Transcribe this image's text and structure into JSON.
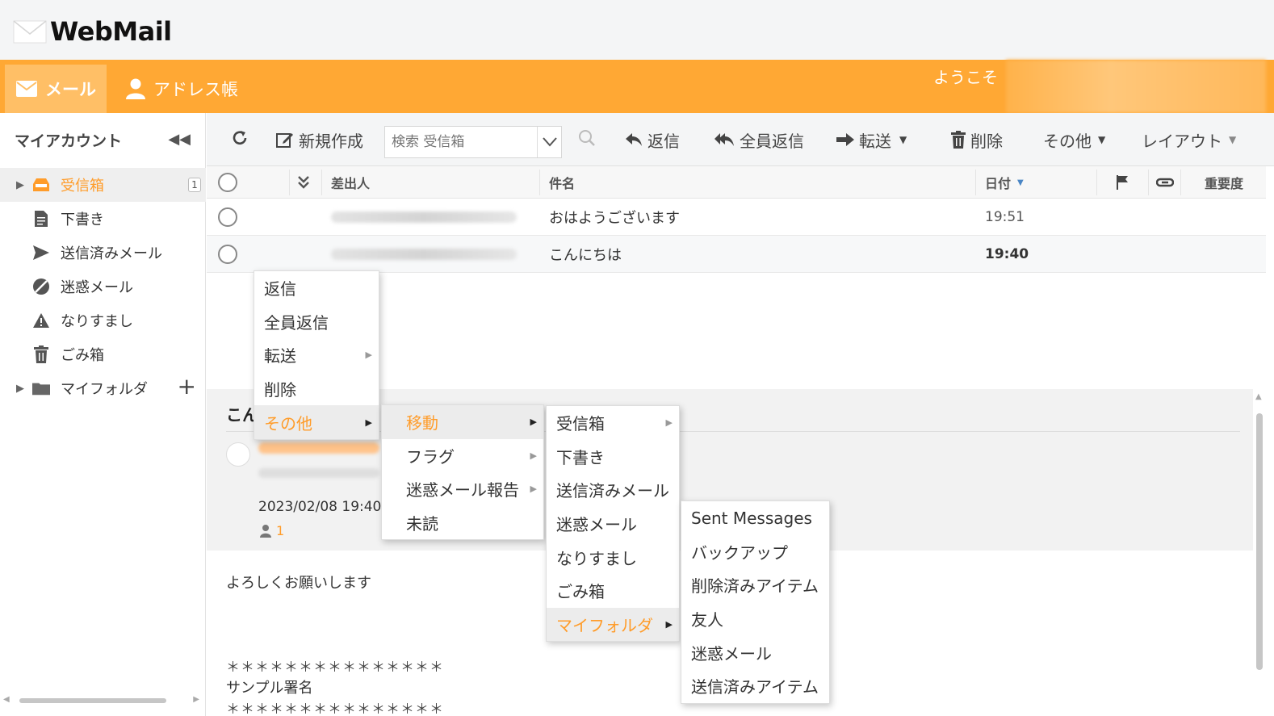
{
  "app": {
    "title": "WebMail"
  },
  "nav": {
    "mail": "メール",
    "address_book": "アドレス帳",
    "welcome": "ようこそ"
  },
  "sidebar": {
    "heading": "マイアカウント",
    "folders": [
      {
        "label": "受信箱",
        "badge": "1"
      },
      {
        "label": "下書き"
      },
      {
        "label": "送信済みメール"
      },
      {
        "label": "迷惑メール"
      },
      {
        "label": "なりすまし"
      },
      {
        "label": "ごみ箱"
      },
      {
        "label": "マイフォルダ"
      }
    ]
  },
  "toolbar": {
    "new": "新規作成",
    "search_placeholder": "検索 受信箱",
    "reply": "返信",
    "reply_all": "全員返信",
    "forward": "転送",
    "delete": "削除",
    "other": "その他",
    "layout": "レイアウト"
  },
  "list": {
    "columns": {
      "sender": "差出人",
      "subject": "件名",
      "date": "日付",
      "importance": "重要度"
    },
    "rows": [
      {
        "subject": "おはようございます",
        "time": "19:51"
      },
      {
        "subject": "こんにちは",
        "time": "19:40"
      }
    ]
  },
  "preview": {
    "subject": "こん",
    "date": "2023/02/08 19:40",
    "recipient_count": "1",
    "body": "よろしくお願いします",
    "stars": "＊＊＊＊＊＊＊＊＊＊＊＊＊＊＊",
    "signature": "サンプル署名"
  },
  "context_menu": {
    "main": [
      "返信",
      "全員返信",
      "転送",
      "削除",
      "その他"
    ],
    "other": [
      "移動",
      "フラグ",
      "迷惑メール報告",
      "未読"
    ],
    "move": [
      "受信箱",
      "下書き",
      "送信済みメール",
      "迷惑メール",
      "なりすまし",
      "ごみ箱",
      "マイフォルダ"
    ],
    "my_folder": [
      "Sent Messages",
      "バックアップ",
      "削除済みアイテム",
      "友人",
      "迷惑メール",
      "送信済みアイテム"
    ]
  },
  "colors": {
    "accent": "#ffa834",
    "highlight_text": "#ff9c2a"
  }
}
